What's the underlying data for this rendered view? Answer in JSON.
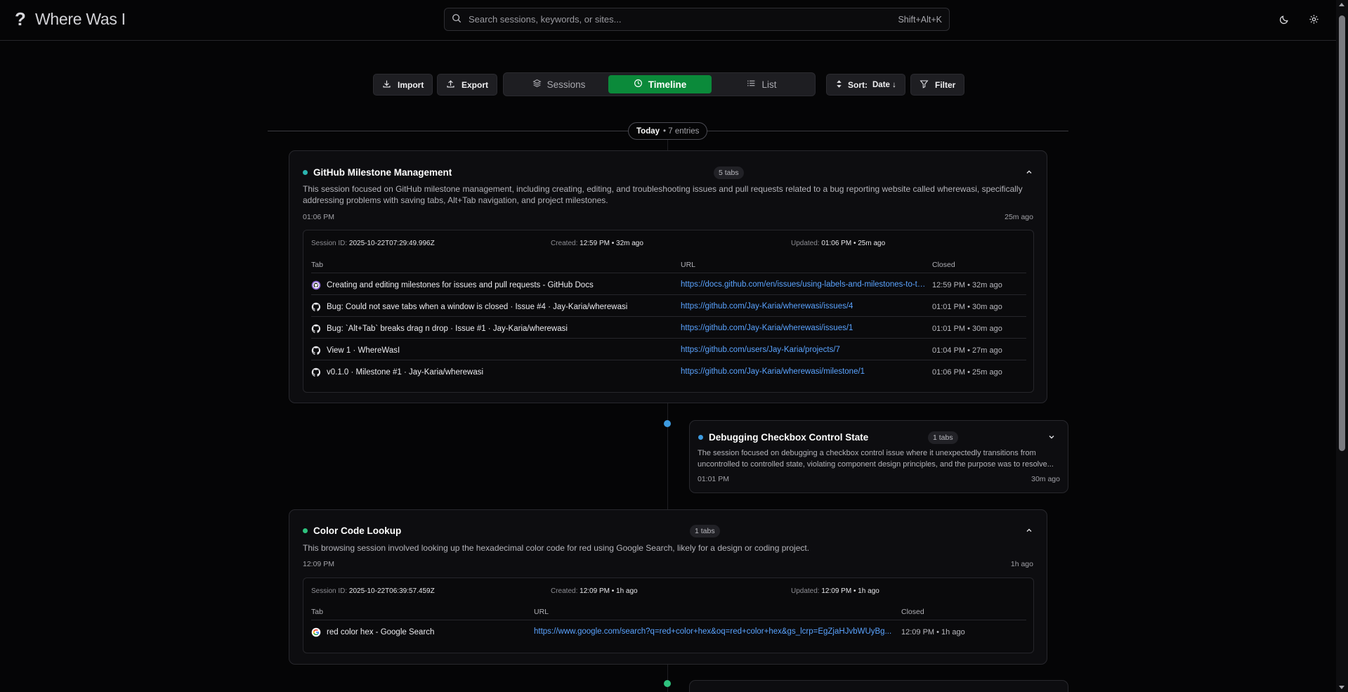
{
  "app": {
    "title": "Where Was I",
    "logo_glyph": "?"
  },
  "search": {
    "placeholder": "Search sessions, keywords, or sites...",
    "shortcut": "Shift+Alt+K"
  },
  "header": {
    "theme_icon": "moon-icon",
    "settings_icon": "gear-icon"
  },
  "toolbar": {
    "import_label": "Import",
    "export_label": "Export",
    "views": [
      {
        "label": "Sessions",
        "icon": "layers-icon",
        "active": false
      },
      {
        "label": "Timeline",
        "icon": "clock-icon",
        "active": true
      },
      {
        "label": "List",
        "icon": "list-icon",
        "active": false
      }
    ],
    "sort_label": "Sort:",
    "sort_value": "Date ↓",
    "filter_label": "Filter"
  },
  "colors": {
    "accent_green": "#0b8a3a",
    "dot_teal": "#2bb5b0",
    "dot_blue": "#3d9be0",
    "dot_green": "#2ec27e",
    "link": "#5aa3ff"
  },
  "group": {
    "label": "Today",
    "count": "• 7 entries"
  },
  "sessions": [
    {
      "title": "GitHub Milestone Management",
      "tabs_badge": "5 tabs",
      "expanded": true,
      "summary": "This session focused on GitHub milestone management, including creating, editing, and troubleshooting issues and pull requests related to a bug reporting website called wherewasi, specifically addressing problems with saving tabs, Alt+Tab navigation, and project milestones.",
      "time": "01:06 PM",
      "ago": "25m ago",
      "session_id_label": "Session ID:",
      "session_id": "2025-10-22T07:29:49.996Z",
      "created_label": "Created:",
      "created": "12:59 PM • 32m ago",
      "updated_label": "Updated:",
      "updated": "01:06 PM • 25m ago",
      "columns": [
        "Tab",
        "URL",
        "Closed"
      ],
      "rows": [
        {
          "icon": "github-docs-icon",
          "title": "Creating and editing milestones for issues and pull requests - GitHub Docs",
          "url": "https://docs.github.com/en/issues/using-labels-and-milestones-to-track-work/about-milestones",
          "closed": "12:59 PM • 32m ago"
        },
        {
          "icon": "github-icon",
          "title": "Bug: Could not save tabs when a window is closed · Issue #4 · Jay-Karia/wherewasi",
          "url": "https://github.com/Jay-Karia/wherewasi/issues/4",
          "closed": "01:01 PM • 30m ago"
        },
        {
          "icon": "github-icon",
          "title": "Bug: `Alt+Tab` breaks drag n drop · Issue #1 · Jay-Karia/wherewasi",
          "url": "https://github.com/Jay-Karia/wherewasi/issues/1",
          "closed": "01:01 PM • 30m ago"
        },
        {
          "icon": "github-icon",
          "title": "View 1 · WhereWasI",
          "url": "https://github.com/users/Jay-Karia/projects/7",
          "closed": "01:04 PM • 27m ago"
        },
        {
          "icon": "github-icon",
          "title": "v0.1.0 · Milestone #1 · Jay-Karia/wherewasi",
          "url": "https://github.com/Jay-Karia/wherewasi/milestone/1",
          "closed": "01:06 PM • 25m ago"
        }
      ]
    },
    {
      "title": "Debugging Checkbox Control State",
      "tabs_badge": "1 tabs",
      "expanded": false,
      "summary": "The session focused on debugging a checkbox control issue where it unexpectedly transitions from uncontrolled to controlled state, violating component design principles, and the purpose was to resolve...",
      "time": "01:01 PM",
      "ago": "30m ago"
    },
    {
      "title": "Color Code Lookup",
      "tabs_badge": "1 tabs",
      "expanded": true,
      "summary": "This browsing session involved looking up the hexadecimal color code for red using Google Search, likely for a design or coding project.",
      "time": "12:09 PM",
      "ago": "1h ago",
      "session_id_label": "Session ID:",
      "session_id": "2025-10-22T06:39:57.459Z",
      "created_label": "Created:",
      "created": "12:09 PM • 1h ago",
      "updated_label": "Updated:",
      "updated": "12:09 PM • 1h ago",
      "columns": [
        "Tab",
        "URL",
        "Closed"
      ],
      "rows": [
        {
          "icon": "google-icon",
          "title": "red color hex - Google Search",
          "url": "https://www.google.com/search?q=red+color+hex&oq=red+color+hex&gs_lcrp=EgZjaHJvbWUyBg...",
          "closed": "12:09 PM • 1h ago"
        }
      ]
    }
  ]
}
